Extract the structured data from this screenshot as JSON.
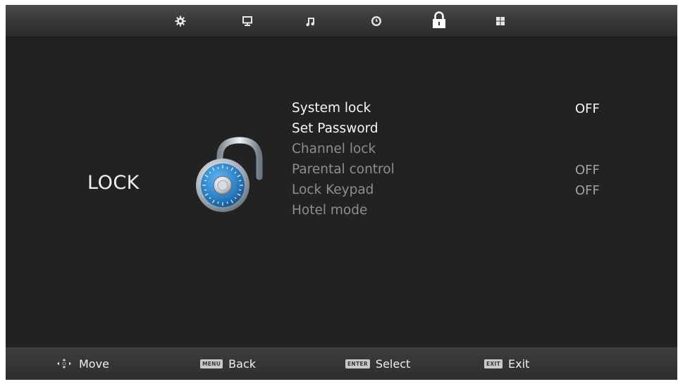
{
  "section_title": "LOCK",
  "tabs": [
    {
      "icon": "gear-icon"
    },
    {
      "icon": "monitor-icon"
    },
    {
      "icon": "music-note-icon"
    },
    {
      "icon": "clock-icon"
    },
    {
      "icon": "lock-icon",
      "selected": true
    },
    {
      "icon": "grid-icon"
    }
  ],
  "menu": [
    {
      "label": "System lock",
      "value": "OFF",
      "enabled": true
    },
    {
      "label": "Set Password",
      "value": "",
      "enabled": true
    },
    {
      "label": "Channel lock",
      "value": "",
      "enabled": false
    },
    {
      "label": "Parental control",
      "value": "OFF",
      "enabled": false
    },
    {
      "label": "Lock Keypad",
      "value": "OFF",
      "enabled": false
    },
    {
      "label": "Hotel mode",
      "value": "",
      "enabled": false
    }
  ],
  "hints": [
    {
      "key": "",
      "label": "Move",
      "icon": "dpad-icon"
    },
    {
      "key": "MENU",
      "label": "Back"
    },
    {
      "key": "ENTER",
      "label": "Select"
    },
    {
      "key": "EXIT",
      "label": "Exit"
    }
  ],
  "colors": {
    "background": "#222222",
    "text_enabled": "#f7f7f7",
    "text_disabled": "#8e8e8e",
    "lock_dial": "#2a7fc4"
  }
}
